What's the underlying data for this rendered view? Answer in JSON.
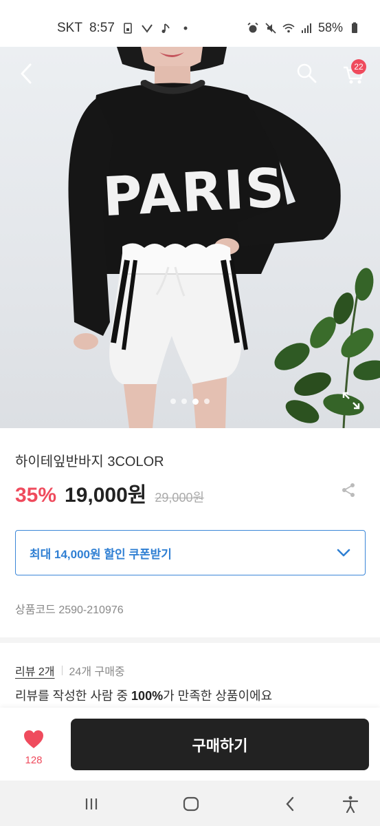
{
  "status_bar": {
    "carrier": "SKT",
    "time": "8:57",
    "battery": "58%"
  },
  "hero": {
    "shirt_text": "PARIS",
    "cart_count": "22",
    "image_index": 3,
    "image_total": 4
  },
  "product": {
    "title": "하이테잎반바지 3COLOR",
    "discount": "35%",
    "price": "19,000원",
    "original_price": "29,000원",
    "coupon_label": "최대 14,000원 할인 쿠폰받기",
    "code": "상품코드 2590-210976"
  },
  "reviews": {
    "link": "리뷰 2개",
    "buyers": "24개 구매중",
    "satisfaction_pre": "리뷰를 작성한 사람 중 ",
    "satisfaction_pct": "100%",
    "satisfaction_post": "가 만족한 상품이에요"
  },
  "buy_bar": {
    "like_count": "128",
    "buy_label": "구매하기"
  },
  "colors": {
    "accent_red": "#ef4b5d",
    "coupon_blue": "#2f7fd3",
    "buy_button": "#222222"
  },
  "icons": [
    "back-icon",
    "search-icon",
    "cart-icon",
    "expand-icon",
    "share-icon",
    "chevron-down-icon",
    "heart-icon",
    "recent-apps-icon",
    "home-icon",
    "back-nav-icon",
    "accessibility-icon"
  ]
}
